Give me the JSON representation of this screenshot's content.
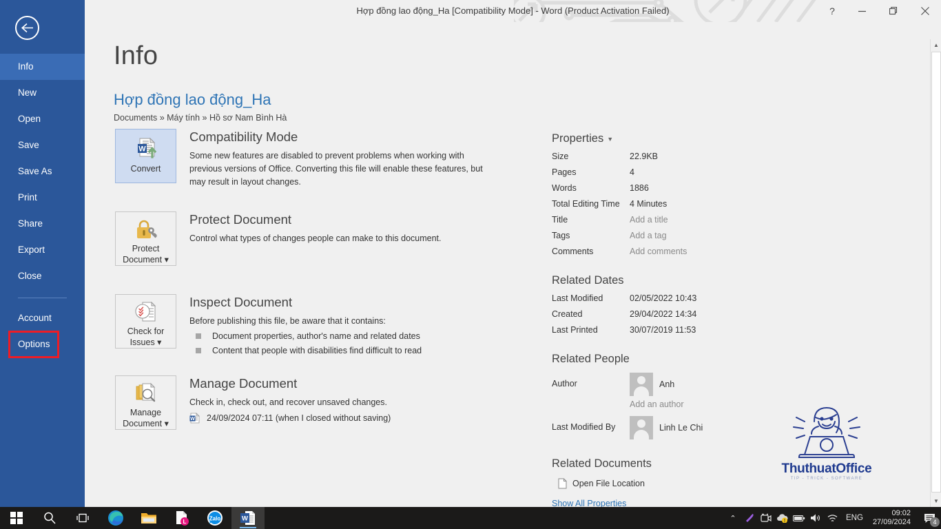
{
  "window": {
    "title": "Hợp đồng lao động_Ha [Compatibility Mode] - Word (Product Activation Failed)",
    "help_label": "?",
    "minimize_label": "—",
    "restore_label": "❐",
    "close_label": "✕"
  },
  "sidebar": {
    "back_label": "Back",
    "items": [
      {
        "label": "Info",
        "active": true
      },
      {
        "label": "New",
        "active": false
      },
      {
        "label": "Open",
        "active": false
      },
      {
        "label": "Save",
        "active": false
      },
      {
        "label": "Save As",
        "active": false
      },
      {
        "label": "Print",
        "active": false
      },
      {
        "label": "Share",
        "active": false
      },
      {
        "label": "Export",
        "active": false
      },
      {
        "label": "Close",
        "active": false
      }
    ],
    "footer_items": [
      {
        "label": "Account",
        "highlighted": false
      },
      {
        "label": "Options",
        "highlighted": true
      }
    ],
    "highlight_color": "#ee1c25",
    "bg_color": "#2b579a",
    "active_color": "#3a6cb5"
  },
  "main": {
    "page_title": "Info",
    "document_name": "Hợp đồng lao động_Ha",
    "document_path": "Documents » Máy tính » Hồ sơ Nam Bình Hà",
    "cards": [
      {
        "button_label": "Convert",
        "button_icon": "convert-document-icon",
        "highlighted": true,
        "heading": "Compatibility Mode",
        "description": "Some new features are disabled to prevent problems when working with previous versions of Office. Converting this file will enable these features, but may result in layout changes.",
        "bullets": [],
        "version_entry": null
      },
      {
        "button_label": "Protect\nDocument ▾",
        "button_icon": "lock-key-icon",
        "highlighted": false,
        "heading": "Protect Document",
        "description": "Control what types of changes people can make to this document.",
        "bullets": [],
        "version_entry": null
      },
      {
        "button_label": "Check for\nIssues ▾",
        "button_icon": "inspect-document-icon",
        "highlighted": false,
        "heading": "Inspect Document",
        "description": "Before publishing this file, be aware that it contains:",
        "bullets": [
          "Document properties, author's name and related dates",
          "Content that people with disabilities find difficult to read"
        ],
        "version_entry": null
      },
      {
        "button_label": "Manage\nDocument ▾",
        "button_icon": "manage-document-icon",
        "highlighted": false,
        "heading": "Manage Document",
        "description": "Check in, check out, and recover unsaved changes.",
        "bullets": [],
        "version_entry": "24/09/2024 07:11 (when I closed without saving)"
      }
    ]
  },
  "properties": {
    "heading": "Properties",
    "rows": [
      {
        "key": "Size",
        "value": "22.9KB",
        "muted": false
      },
      {
        "key": "Pages",
        "value": "4",
        "muted": false
      },
      {
        "key": "Words",
        "value": "1886",
        "muted": false
      },
      {
        "key": "Total Editing Time",
        "value": "4 Minutes",
        "muted": false
      },
      {
        "key": "Title",
        "value": "Add a title",
        "muted": true
      },
      {
        "key": "Tags",
        "value": "Add a tag",
        "muted": true
      },
      {
        "key": "Comments",
        "value": "Add comments",
        "muted": true
      }
    ],
    "related_dates": {
      "heading": "Related Dates",
      "rows": [
        {
          "key": "Last Modified",
          "value": "02/05/2022 10:43"
        },
        {
          "key": "Created",
          "value": "29/04/2022 14:34"
        },
        {
          "key": "Last Printed",
          "value": "30/07/2019 11:53"
        }
      ]
    },
    "related_people": {
      "heading": "Related People",
      "author_key": "Author",
      "author_name": "Anh",
      "add_author": "Add an author",
      "modified_key": "Last Modified By",
      "modified_name": "Linh Le Chi"
    },
    "related_documents": {
      "heading": "Related Documents",
      "open_location": "Open File Location"
    },
    "show_all": "Show All Properties"
  },
  "watermark": {
    "name": "ThuthuatOffice",
    "tagline": "TIP - TRICK - SOFTWARE"
  },
  "taskbar": {
    "items": [
      {
        "name": "start-button",
        "icon": "windows-logo-icon",
        "active": false,
        "running": false
      },
      {
        "name": "search-button",
        "icon": "search-icon",
        "active": false,
        "running": false
      },
      {
        "name": "task-view-button",
        "icon": "task-view-icon",
        "active": false,
        "running": false
      },
      {
        "name": "edge-button",
        "icon": "edge-icon",
        "active": false,
        "running": true
      },
      {
        "name": "file-explorer-button",
        "icon": "folder-icon",
        "active": false,
        "running": true
      },
      {
        "name": "lightshot-button",
        "icon": "document-l-badge-icon",
        "active": false,
        "running": true
      },
      {
        "name": "zalo-button",
        "icon": "zalo-icon",
        "active": false,
        "running": true
      },
      {
        "name": "word-button",
        "icon": "word-icon",
        "active": true,
        "running": true
      }
    ],
    "tray": {
      "chevron": "⌃",
      "icons": [
        "pen-icon",
        "camera-icon",
        "onedrive-warning-icon",
        "battery-icon",
        "volume-icon",
        "wifi-icon"
      ],
      "language": "ENG",
      "time": "09:02",
      "date": "27/09/2024",
      "notification_count": "4"
    }
  }
}
